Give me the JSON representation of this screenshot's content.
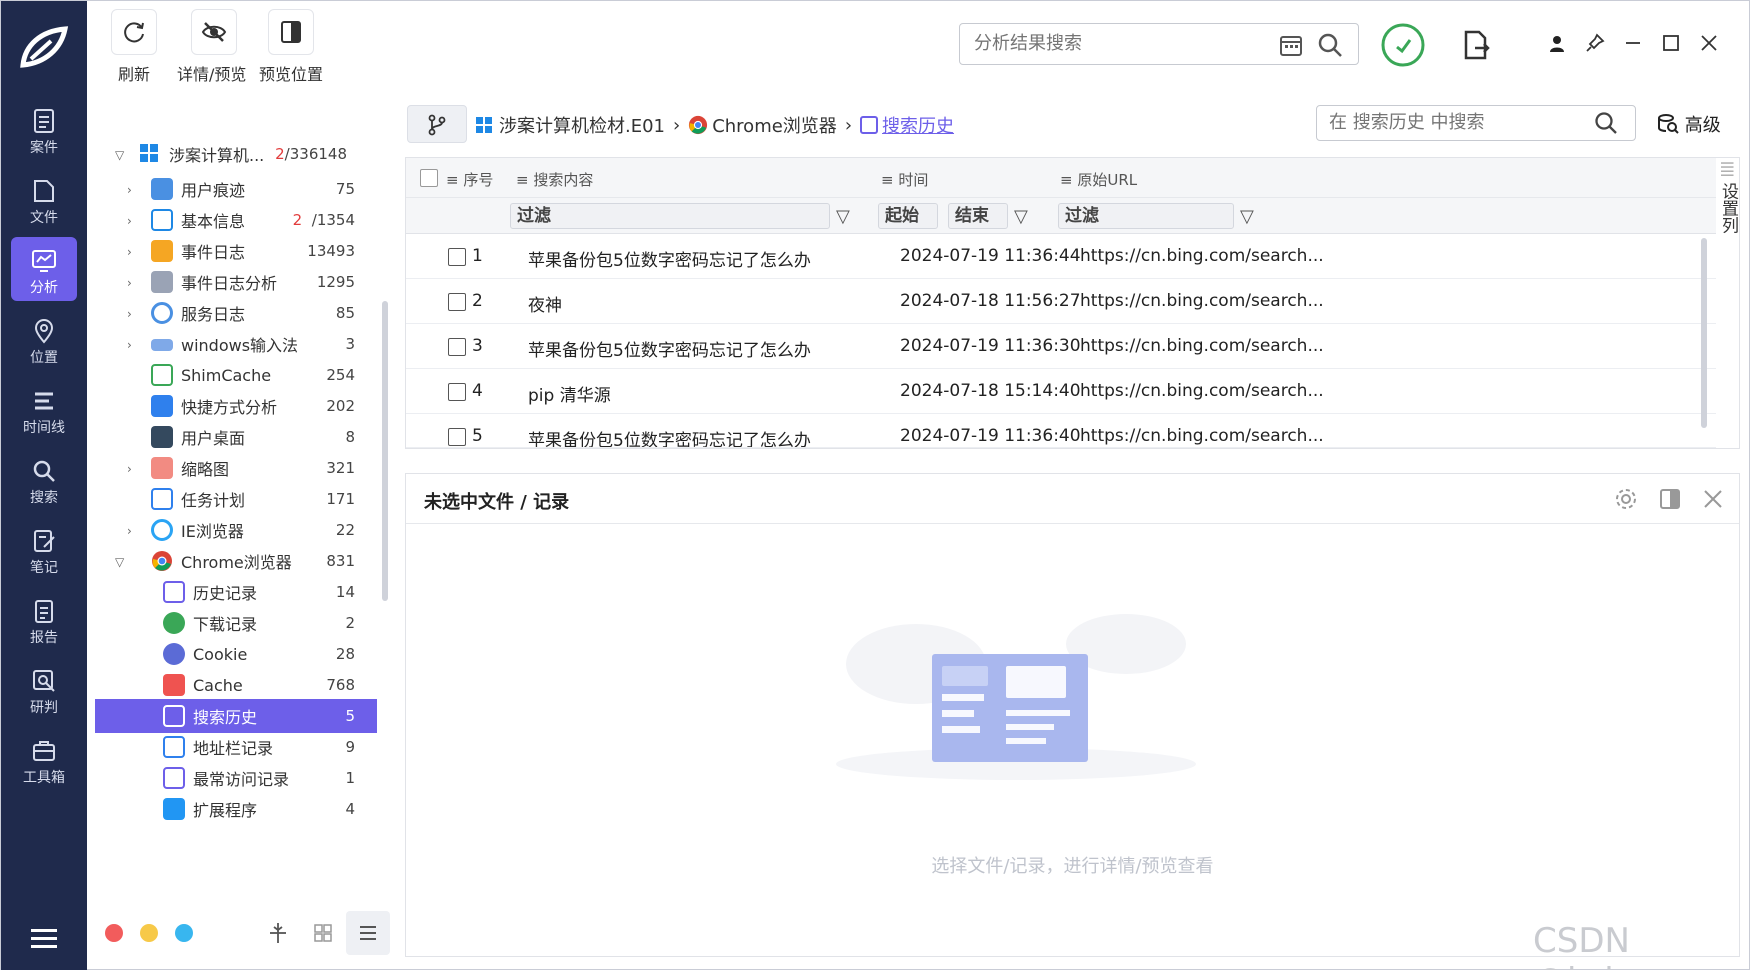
{
  "nav": {
    "items": [
      {
        "label": "案件",
        "icon": "case-icon"
      },
      {
        "label": "文件",
        "icon": "file-icon"
      },
      {
        "label": "分析",
        "icon": "analysis-icon",
        "active": true
      },
      {
        "label": "位置",
        "icon": "location-icon"
      },
      {
        "label": "时间线",
        "icon": "timeline-icon"
      },
      {
        "label": "搜索",
        "icon": "search-icon"
      },
      {
        "label": "笔记",
        "icon": "note-icon"
      },
      {
        "label": "报告",
        "icon": "report-icon"
      },
      {
        "label": "研判",
        "icon": "judge-icon"
      },
      {
        "label": "工具箱",
        "icon": "toolbox-icon"
      }
    ]
  },
  "toolbar": {
    "refresh": "刷新",
    "detail_preview": "详情/预览",
    "preview_position": "预览位置",
    "search_placeholder": "分析结果搜索"
  },
  "tree": {
    "root": {
      "label": "涉案计算机...",
      "count_selected": "2",
      "count_total": "/336148"
    },
    "items": [
      {
        "label": "用户痕迹",
        "count": "75"
      },
      {
        "label": "基本信息",
        "count_red": "2",
        "count": "/1354"
      },
      {
        "label": "事件日志",
        "count": "13493"
      },
      {
        "label": "事件日志分析",
        "count": "1295"
      },
      {
        "label": "服务日志",
        "count": "85"
      },
      {
        "label": "windows输入法",
        "count": "3"
      },
      {
        "label": "ShimCache",
        "count": "254"
      },
      {
        "label": "快捷方式分析",
        "count": "202"
      },
      {
        "label": "用户桌面",
        "count": "8"
      },
      {
        "label": "缩略图",
        "count": "321"
      },
      {
        "label": "任务计划",
        "count": "171"
      },
      {
        "label": "IE浏览器",
        "count": "22"
      },
      {
        "label": "Chrome浏览器",
        "count": "831"
      },
      {
        "label": "历史记录",
        "count": "14"
      },
      {
        "label": "下载记录",
        "count": "2"
      },
      {
        "label": "Cookie",
        "count": "28"
      },
      {
        "label": "Cache",
        "count": "768"
      },
      {
        "label": "搜索历史",
        "count": "5",
        "selected": true
      },
      {
        "label": "地址栏记录",
        "count": "9"
      },
      {
        "label": "最常访问记录",
        "count": "1"
      },
      {
        "label": "扩展程序",
        "count": "4"
      }
    ]
  },
  "breadcrumb": {
    "part1": "涉案计算机检材.E01",
    "part2": "Chrome浏览器",
    "part3": "搜索历史"
  },
  "search2": {
    "placeholder": "在 搜索历史 中搜索",
    "advanced": "高级"
  },
  "table": {
    "columns": {
      "seq": "序号",
      "content": "搜索内容",
      "time": "时间",
      "url": "原始URL"
    },
    "filters": {
      "filter": "过滤",
      "start": "起始",
      "end": "结束"
    },
    "rows": [
      {
        "seq": "1",
        "content": "苹果备份包5位数字密码忘记了怎么办",
        "time": "2024-07-19 11:36:44",
        "url": "https://cn.bing.com/search..."
      },
      {
        "seq": "2",
        "content": "夜神",
        "time": "2024-07-18 11:56:27",
        "url": "https://cn.bing.com/search..."
      },
      {
        "seq": "3",
        "content": "苹果备份包5位数字密码忘记了怎么办",
        "time": "2024-07-19 11:36:30",
        "url": "https://cn.bing.com/search..."
      },
      {
        "seq": "4",
        "content": "pip 清华源",
        "time": "2024-07-18 15:14:40",
        "url": "https://cn.bing.com/search..."
      },
      {
        "seq": "5",
        "content": "苹果备份包5位数字密码忘记了怎么办",
        "time": "2024-07-19 11:36:40",
        "url": "https://cn.bing.com/search..."
      }
    ],
    "side_label": "设置列"
  },
  "panel": {
    "title": "未选中文件 / 记录",
    "empty_text": "选择文件/记录，进行详情/预览查看"
  },
  "watermark": "CSDN @iwlmo",
  "colors": {
    "nav_bg": "#1f2a4c",
    "accent": "#6d5fe9",
    "green": "#3aa757"
  }
}
